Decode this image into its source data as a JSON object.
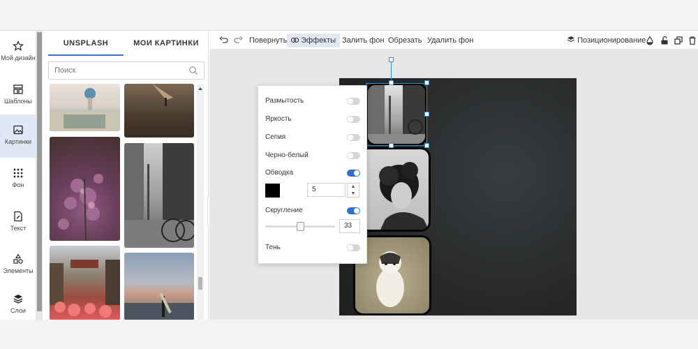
{
  "rail": {
    "items": [
      {
        "label": "Мой дизайн",
        "icon": "star-icon"
      },
      {
        "label": "Шаблоны",
        "icon": "templates-icon"
      },
      {
        "label": "Картинки",
        "icon": "image-icon",
        "active": true
      },
      {
        "label": "Фон",
        "icon": "dots-grid-icon"
      },
      {
        "label": "Текст",
        "icon": "text-doc-icon"
      },
      {
        "label": "Элементы",
        "icon": "shapes-icon"
      },
      {
        "label": "Слои",
        "icon": "layers-icon"
      }
    ]
  },
  "panel": {
    "tabs": [
      "UNSPLASH",
      "МОИ КАРТИНКИ"
    ],
    "active_tab": "UNSPLASH",
    "search_placeholder": "Поиск"
  },
  "toolbar": {
    "rotate": "Повернуть",
    "effects": "Эффекты",
    "fill_bg": "Залить фон",
    "crop": "Обрезать",
    "remove_bg": "Удалить фон",
    "positioning": "Позиционирование"
  },
  "effects": {
    "blur": {
      "label": "Размытость",
      "on": false
    },
    "brightness": {
      "label": "Яркость",
      "on": false
    },
    "sepia": {
      "label": "Сепия",
      "on": false
    },
    "bw": {
      "label": "Черно-белый",
      "on": false
    },
    "stroke": {
      "label": "Обводка",
      "on": true,
      "color": "#000000",
      "width": "5"
    },
    "rounding": {
      "label": "Скругление",
      "on": true,
      "value": "33",
      "slider_fraction": 0.33
    },
    "shadow": {
      "label": "Тень",
      "on": false
    }
  },
  "colors": {
    "accent": "#2f6fd0",
    "selection": "#2f8fd8",
    "canvas_bg": "#2b2d2f"
  }
}
